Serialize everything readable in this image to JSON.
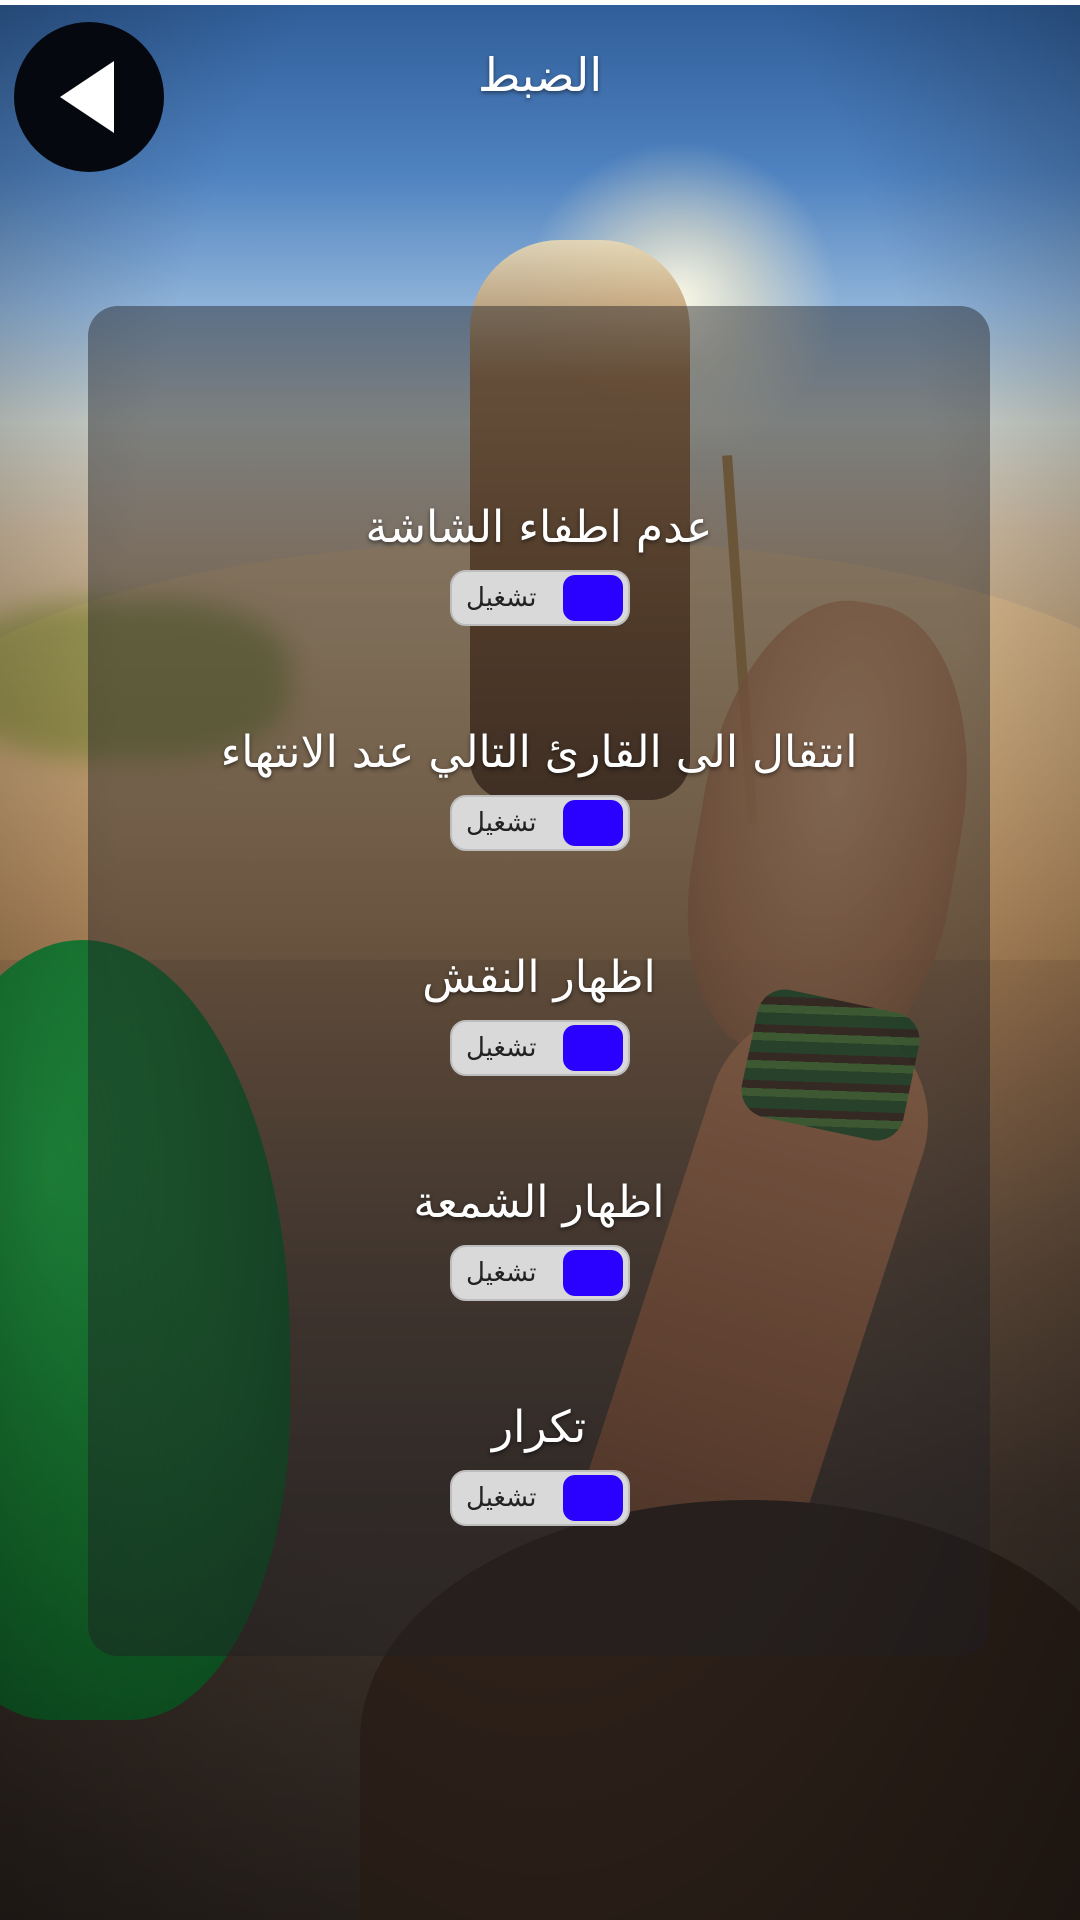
{
  "header": {
    "title": "الضبط",
    "back_icon": "back-arrow-icon"
  },
  "settings": [
    {
      "label": "عدم اطفاء الشاشة",
      "toggle_text": "تشغيل"
    },
    {
      "label": "انتقال الى القارئ التالي عند الانتهاء",
      "toggle_text": "تشغيل"
    },
    {
      "label": "اظهار النقش",
      "toggle_text": "تشغيل"
    },
    {
      "label": "اظهار الشمعة",
      "toggle_text": "تشغيل"
    },
    {
      "label": "تكرار",
      "toggle_text": "تشغيل"
    }
  ],
  "colors": {
    "toggle_knob": "#2a00ff",
    "toggle_track": "#d9d9d9",
    "back_button": "#06080f",
    "text": "#ffffff"
  }
}
